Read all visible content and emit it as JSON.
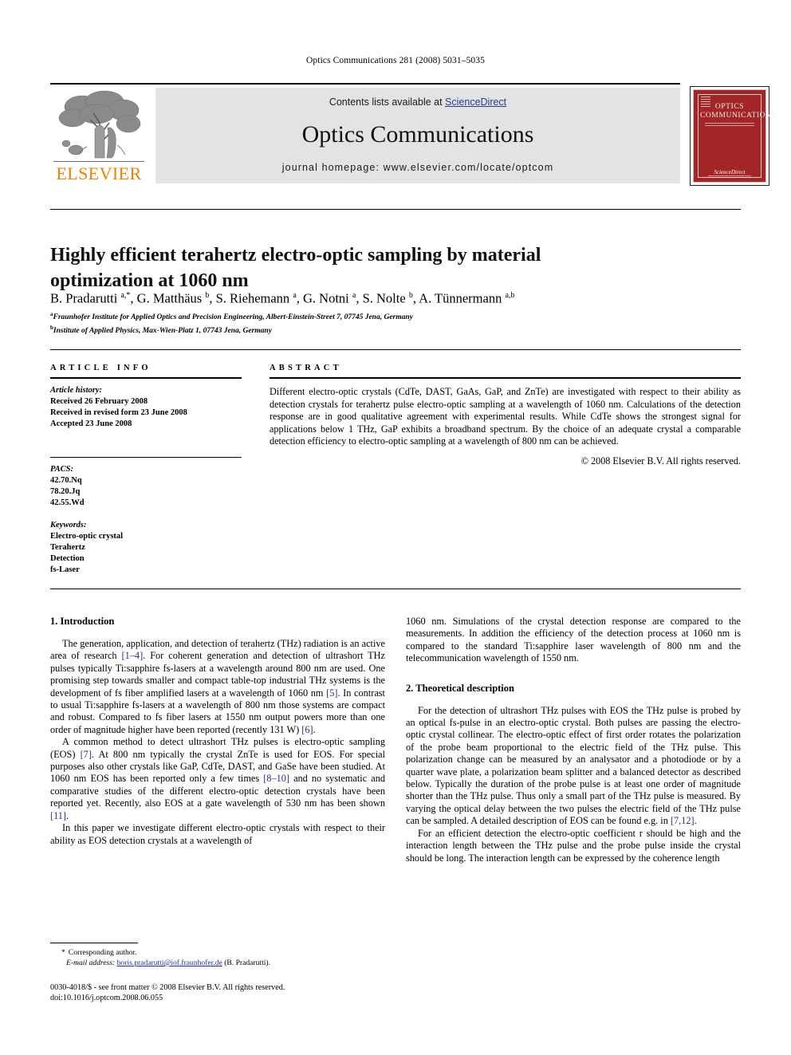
{
  "running_head": "Optics Communications 281 (2008) 5031–5035",
  "masthead": {
    "contents_prefix": "Contents lists available at ",
    "science_direct": "ScienceDirect",
    "journal_name": "Optics Communications",
    "homepage": "journal homepage: www.elsevier.com/locate/optcom",
    "publisher_wordmark": "ELSEVIER",
    "band_color": "#e3e3e3",
    "link_color": "#2b3a8f",
    "wordmark_color": "#f08000"
  },
  "cover": {
    "title_line1": "OPTICS",
    "title_line2": "COMMUNICATIONS",
    "sciencedirect": "ScienceDirect",
    "background_color": "#a32626"
  },
  "article": {
    "title": "Highly efficient terahertz electro-optic sampling by material optimization at 1060 nm",
    "authors_html": "B. Pradarutti <sup>a,*</sup>, G. Matthäus <sup>b</sup>, S. Riehemann <sup>a</sup>, G. Notni <sup>a</sup>, S. Nolte <sup>b</sup>, A. Tünnermann <sup>a,b</sup>",
    "affiliation_a": "Fraunhofer Institute for Applied Optics and Precision Engineering, Albert-Einstein-Street 7, 07745 Jena, Germany",
    "affiliation_b": "Institute of Applied Physics, Max-Wien-Platz 1, 07743 Jena, Germany"
  },
  "article_info": {
    "kicker": "ARTICLE INFO",
    "history_label": "Article history:",
    "history": [
      "Received 26 February 2008",
      "Received in revised form 23 June 2008",
      "Accepted 23 June 2008"
    ],
    "pacs_label": "PACS:",
    "pacs": [
      "42.70.Nq",
      "78.20.Jq",
      "42.55.Wd"
    ],
    "keywords_label": "Keywords:",
    "keywords": [
      "Electro-optic crystal",
      "Terahertz",
      "Detection",
      "fs-Laser"
    ]
  },
  "abstract": {
    "kicker": "ABSTRACT",
    "text": "Different electro-optic crystals (CdTe, DAST, GaAs, GaP, and ZnTe) are investigated with respect to their ability as detection crystals for terahertz pulse electro-optic sampling at a wavelength of 1060 nm. Calculations of the detection response are in good qualitative agreement with experimental results. While CdTe shows the strongest signal for applications below 1 THz, GaP exhibits a broadband spectrum. By the choice of an adequate crystal a comparable detection efficiency to electro-optic sampling at a wavelength of 800 nm can be achieved.",
    "copyright": "© 2008 Elsevier B.V. All rights reserved."
  },
  "sections": {
    "intro_heading": "1. Introduction",
    "intro_p1_html": "The generation, application, and detection of terahertz (THz) radiation is an active area of research <span class=\"ref\">[1–4]</span>. For coherent generation and detection of ultrashort THz pulses typically Ti:sapphire fs-lasers at a wavelength around 800 nm are used. One promising step towards smaller and compact table-top industrial THz systems is the development of fs fiber amplified lasers at a wavelength of 1060 nm <span class=\"ref\">[5]</span>. In contrast to usual Ti:sapphire fs-lasers at a wavelength of 800 nm those systems are compact and robust. Compared to fs fiber lasers at 1550 nm output powers more than one order of magnitude higher have been reported (recently 131 W) <span class=\"ref\">[6]</span>.",
    "intro_p2_html": "A common method to detect ultrashort THz pulses is electro-optic sampling (EOS) <span class=\"ref\">[7]</span>. At 800 nm typically the crystal ZnTe is used for EOS. For special purposes also other crystals like GaP, CdTe, DAST, and GaSe have been studied. At 1060 nm EOS has been reported only a few times <span class=\"ref\">[8–10]</span> and no systematic and comparative studies of the different electro-optic detection crystals have been reported yet. Recently, also EOS at a gate wavelength of 530 nm has been shown <span class=\"ref\">[11]</span>.",
    "intro_p3_html": "In this paper we investigate different electro-optic crystals with respect to their ability as EOS detection crystals at a wavelength of",
    "intro_p3_cont_html": "1060 nm. Simulations of the crystal detection response are compared to the measurements. In addition the efficiency of the detection process at 1060 nm is compared to the standard Ti:sapphire laser wavelength of 800 nm and the telecommunication wavelength of 1550 nm.",
    "theory_heading": "2. Theoretical description",
    "theory_p1_html": "For the detection of ultrashort THz pulses with EOS the THz pulse is probed by an optical fs-pulse in an electro-optic crystal. Both pulses are passing the electro-optic crystal collinear. The electro-optic effect of first order rotates the polarization of the probe beam proportional to the electric field of the THz pulse. This polarization change can be measured by an analysator and a photodiode or by a quarter wave plate, a polarization beam splitter and a balanced detector as described below. Typically the duration of the probe pulse is at least one order of magnitude shorter than the THz pulse. Thus only a small part of the THz pulse is measured. By varying the optical delay between the two pulses the electric field of the THz pulse can be sampled. A detailed description of EOS can be found e.g. in <span class=\"ref\">[7,12]</span>.",
    "theory_p2_html": "For an efficient detection the electro-optic coefficient r should be high and the interaction length between the THz pulse and the probe pulse inside the crystal should be long. The interaction length can be expressed by the coherence length"
  },
  "footnote": {
    "corresponding": "Corresponding author.",
    "email_label": "E-mail address:",
    "email": "boris.pradarutti@iof.fraunhofer.de",
    "email_owner": "(B. Pradarutti)."
  },
  "footer": {
    "imprint": "0030-4018/$ - see front matter © 2008 Elsevier B.V. All rights reserved.",
    "doi": "doi:10.1016/j.optcom.2008.06.055"
  }
}
